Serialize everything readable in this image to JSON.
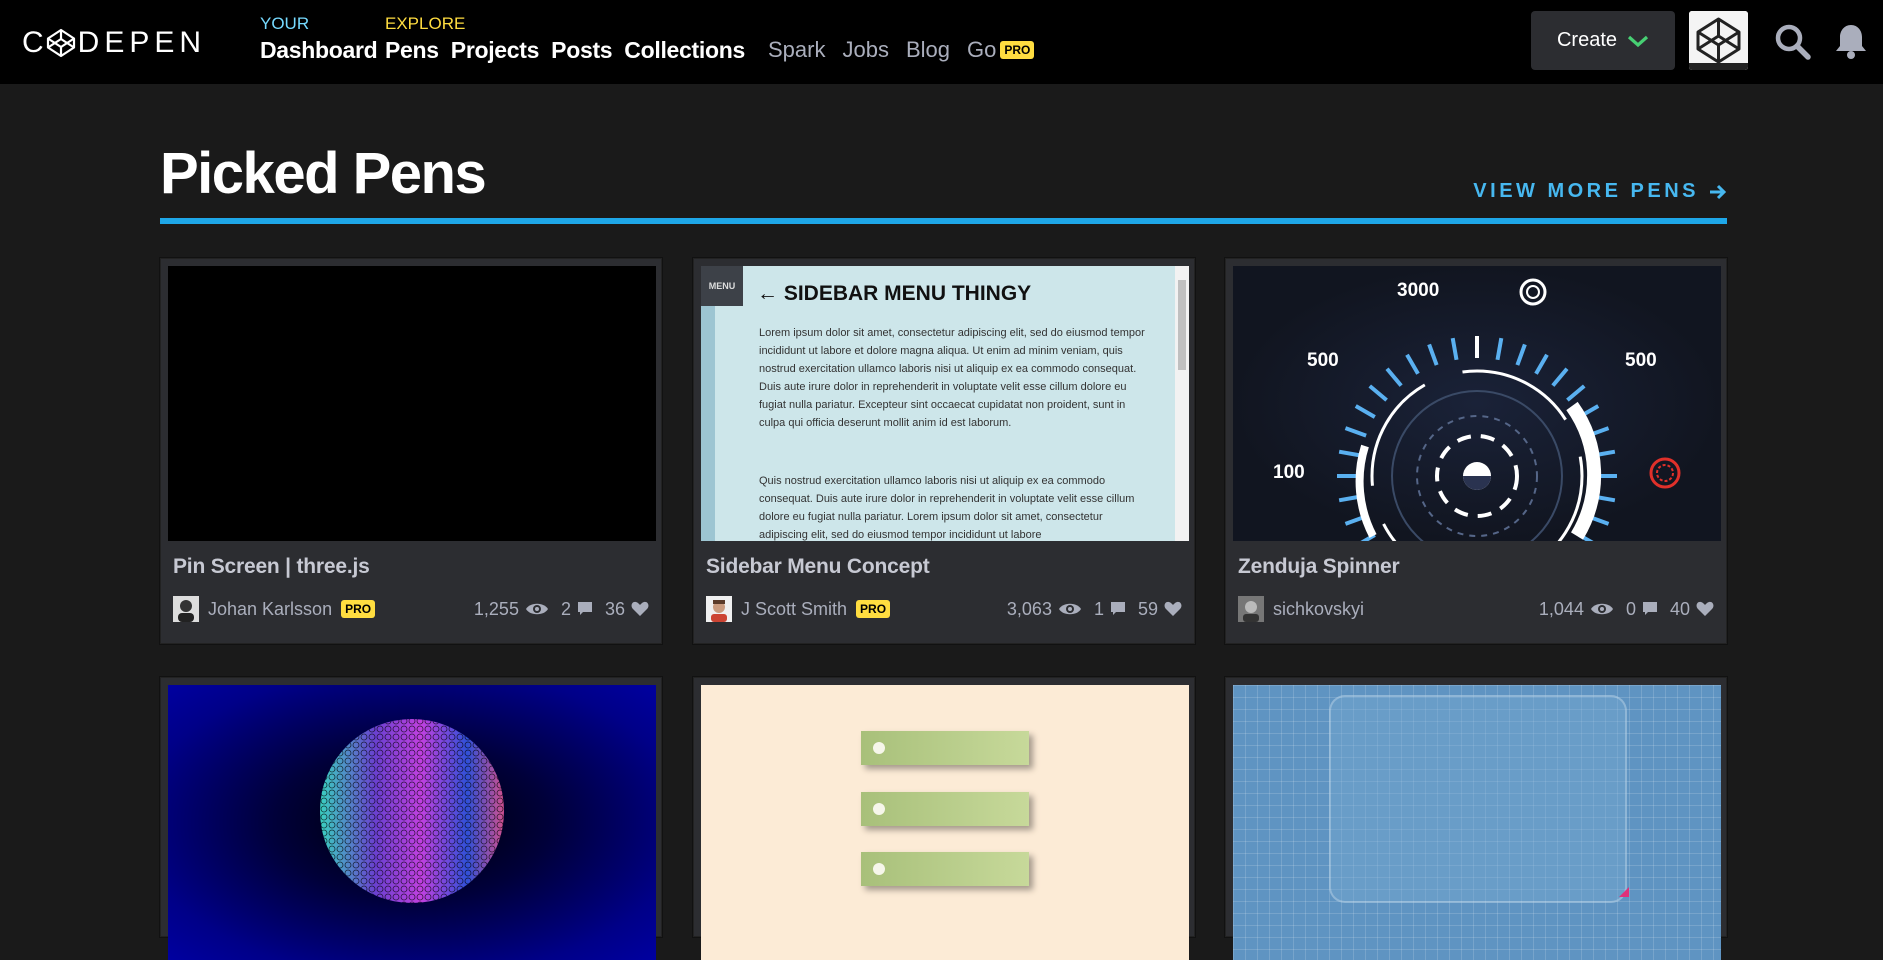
{
  "header": {
    "logo_text": "CODEPEN",
    "your_caption": "YOUR",
    "explore_caption": "EXPLORE",
    "nav_your": [
      "Dashboard"
    ],
    "nav_explore": [
      "Pens",
      "Projects",
      "Posts",
      "Collections"
    ],
    "secondary": [
      "Spark",
      "Jobs",
      "Blog",
      "Go"
    ],
    "go_badge": "PRO",
    "create_label": "Create",
    "colors": {
      "your": "#76daff",
      "explore": "#ffdd40",
      "create_chevron": "#47cf73"
    }
  },
  "section": {
    "title": "Picked Pens",
    "view_more": "VIEW MORE PENS",
    "accent": "#1ea7e8"
  },
  "cards": [
    {
      "title": "Pin Screen | three.js",
      "author": "Johan Karlsson",
      "pro": "PRO",
      "views": "1,255",
      "comments": "2",
      "likes": "36"
    },
    {
      "title": "Sidebar Menu Concept",
      "author": "J Scott Smith",
      "pro": "PRO",
      "views": "3,063",
      "comments": "1",
      "likes": "59",
      "preview": {
        "menu_tab": "MENU",
        "heading": "← SIDEBAR MENU THINGY",
        "para1": "Lorem ipsum dolor sit amet, consectetur adipiscing elit, sed do eiusmod tempor incididunt ut labore et dolore magna aliqua. Ut enim ad minim veniam, quis nostrud exercitation ullamco laboris nisi ut aliquip ex ea commodo consequat. Duis aute irure dolor in reprehenderit in voluptate velit esse cillum dolore eu fugiat nulla pariatur. Excepteur sint occaecat cupidatat non proident, sunt in culpa qui officia deserunt mollit anim id est laborum.",
        "para2": "Quis nostrud exercitation ullamco laboris nisi ut aliquip ex ea commodo consequat. Duis aute irure dolor in reprehenderit in voluptate velit esse cillum dolore eu fugiat nulla pariatur. Lorem ipsum dolor sit amet, consectetur adipiscing elit, sed do eiusmod tempor incididunt ut labore"
      }
    },
    {
      "title": "Zenduja Spinner",
      "author": "sichkovskyi",
      "pro": "",
      "views": "1,044",
      "comments": "0",
      "likes": "40",
      "preview": {
        "top": "3000",
        "left_upper": "500",
        "right_upper": "500",
        "left_lower": "100"
      }
    }
  ]
}
